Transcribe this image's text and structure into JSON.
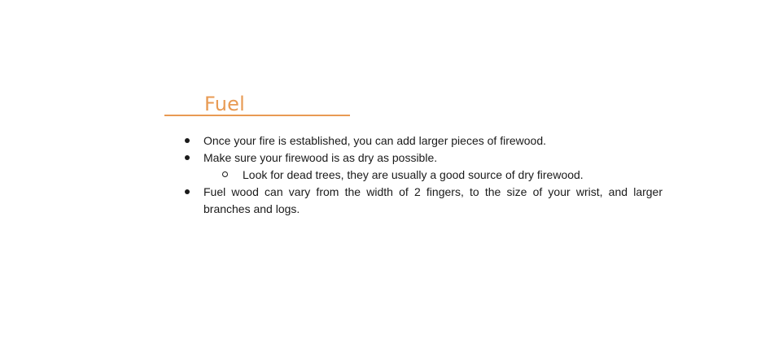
{
  "heading": {
    "title": "Fuel"
  },
  "bullets": {
    "items": [
      "Once your fire is established,  you can add larger pieces of firewood.",
      "Make sure your firewood is as dry as possible.",
      "Fuel wood can vary from the width of 2 fingers, to the size of your wrist, and larger branches and logs."
    ],
    "sub_items": [
      "Look for dead trees, they are usually  a good  source of dry firewood."
    ]
  },
  "colors": {
    "heading_accent": "#e89a53",
    "text": "#1a1a1a",
    "background": "#ffffff"
  },
  "icons": {
    "bullet": "filled-circle-bullet",
    "sub_bullet": "hollow-circle-bullet"
  }
}
